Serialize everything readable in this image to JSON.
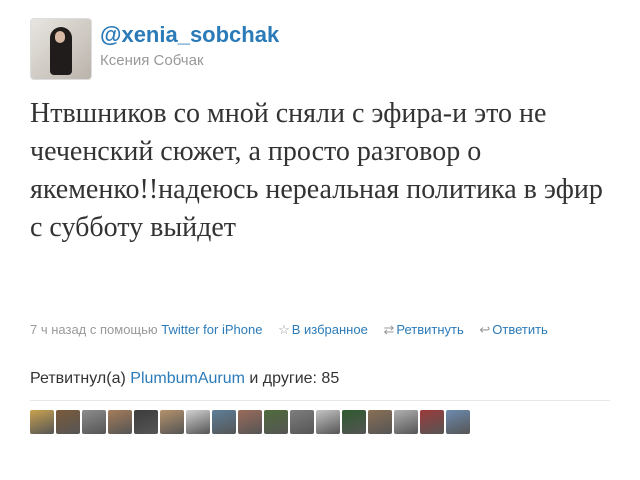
{
  "user": {
    "handle": "@xenia_sobchak",
    "name": "Ксения Собчак"
  },
  "tweet": {
    "text": "Нтвшников со мной сняли с эфира-и это не чеченский сюжет, а просто разговор о якеменко!!надеюсь нереальная политика в эфир с субботу выйдет"
  },
  "meta": {
    "time": "7 ч назад с помощью",
    "client": "Twitter for iPhone",
    "favorite": "В избранное",
    "retweet": "Ретвитнуть",
    "reply": "Ответить",
    "favorite_icon": "star-icon",
    "retweet_icon": "retweet-icon",
    "reply_icon": "reply-icon"
  },
  "retweets": {
    "prefix": "Ретвитнул(а)",
    "user": "PlumbumAurum",
    "suffix": "и другие: 85",
    "avatar_colors": [
      "#c9a24f",
      "#7a5a3a",
      "#8c8c8c",
      "#a57c5a",
      "#3c3c3c",
      "#b5926c",
      "#d1d1d1",
      "#5e7f9a",
      "#9b6b5b",
      "#4f6b3a",
      "#7e7e7e",
      "#c4c4c4",
      "#2e5a2e",
      "#8a6f55",
      "#b0b0b0",
      "#9c3a3a",
      "#6d8bb0"
    ]
  },
  "colors": {
    "link": "#2b7bb9",
    "meta": "#999999",
    "text": "#333333"
  }
}
